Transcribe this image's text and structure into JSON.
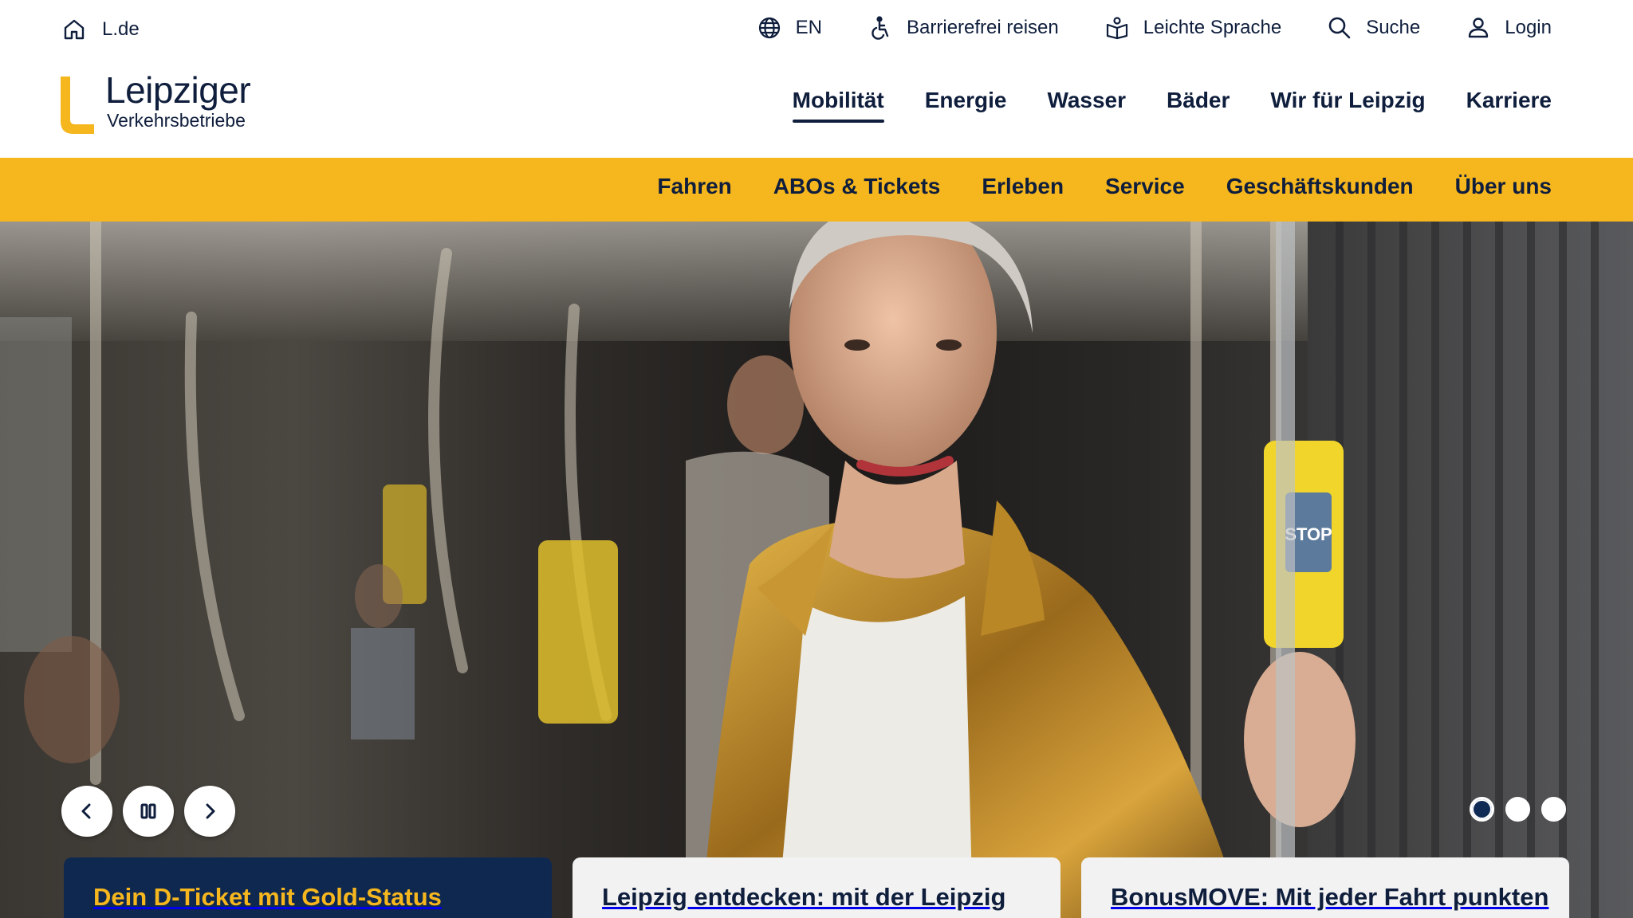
{
  "utility": {
    "home_label": "L.de",
    "items": [
      {
        "label": "EN",
        "icon": "globe-icon"
      },
      {
        "label": "Barrierefrei reisen",
        "icon": "wheelchair-icon"
      },
      {
        "label": "Leichte Sprache",
        "icon": "easy-language-icon"
      },
      {
        "label": "Suche",
        "icon": "search-icon"
      },
      {
        "label": "Login",
        "icon": "user-icon"
      }
    ]
  },
  "logo": {
    "wordmark": "Leipziger",
    "subline": "Verkehrsbetriebe",
    "brand_color": "#f5b61e"
  },
  "main_nav": {
    "items": [
      "Mobilität",
      "Energie",
      "Wasser",
      "Bäder",
      "Wir für Leipzig",
      "Karriere"
    ],
    "active": "Mobilität"
  },
  "sub_nav": {
    "items": [
      "Fahren",
      "ABOs & Tickets",
      "Erleben",
      "Service",
      "Geschäftskunden",
      "Über uns"
    ],
    "background": "#f5b61e"
  },
  "hero": {
    "controls": {
      "prev": "chevron-left-icon",
      "pause": "pause-icon",
      "next": "chevron-right-icon"
    },
    "slide_count": 3,
    "active_slide": 1,
    "stop_button_label": "STOP",
    "teasers": [
      {
        "title": "Dein D-Ticket mit Gold-Status",
        "style": "dark"
      },
      {
        "title": "Leipzig entdecken: mit der Leipzig",
        "style": "light"
      },
      {
        "title": "BonusMOVE: Mit jeder Fahrt punkten",
        "style": "light"
      }
    ]
  },
  "colors": {
    "navy": "#0f1e3c",
    "teaser_dark": "#0f2850",
    "yellow": "#f5b61e"
  }
}
